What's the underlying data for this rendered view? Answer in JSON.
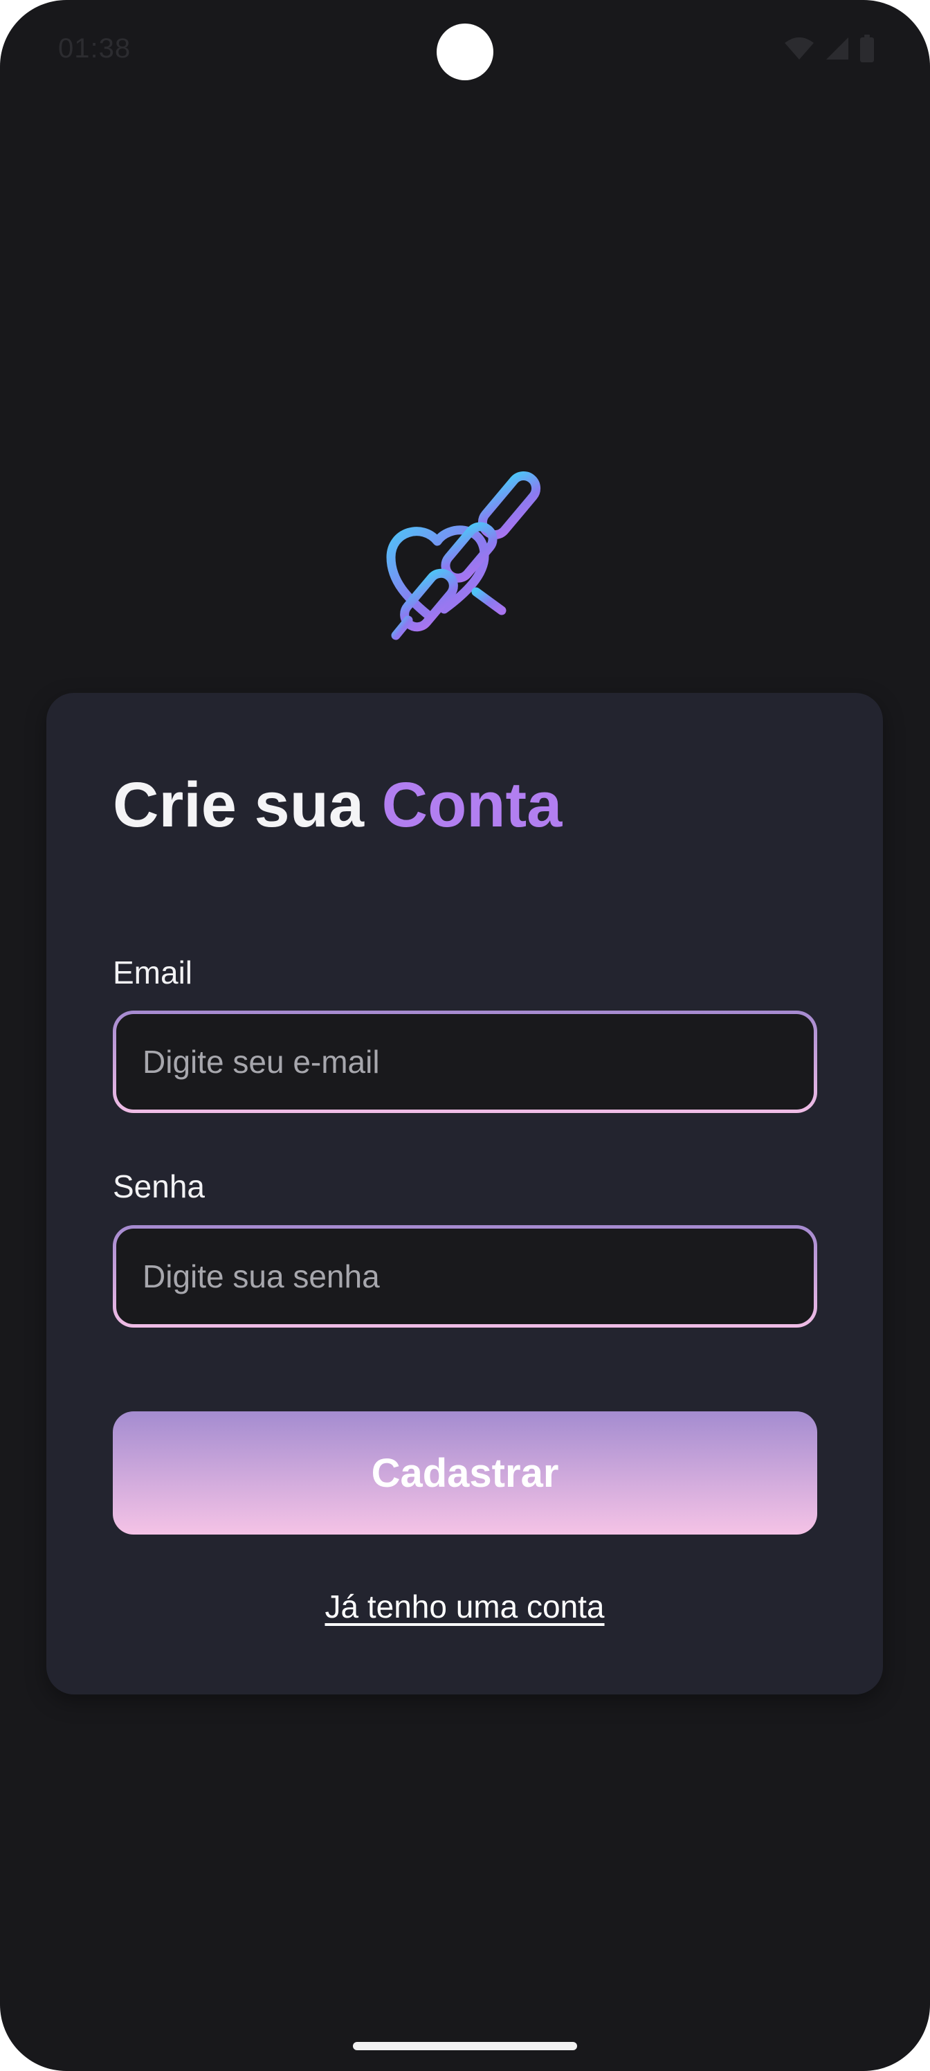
{
  "status_bar": {
    "time": "01:38",
    "icons": [
      "wifi-icon",
      "cellular-signal-icon",
      "battery-icon"
    ]
  },
  "logo": {
    "icon": "heart-chain-logo",
    "gradient": [
      "#4fc3f7",
      "#8b7bf0",
      "#a875f0"
    ]
  },
  "signup": {
    "title_prefix": "Crie sua",
    "title_accent": "Conta",
    "email": {
      "label": "Email",
      "placeholder": "Digite seu e-mail",
      "value": ""
    },
    "password": {
      "label": "Senha",
      "placeholder": "Digite sua senha",
      "value": ""
    },
    "submit_label": "Cadastrar",
    "login_link": "Já tenho uma conta"
  },
  "colors": {
    "background": "#18181b",
    "card": "#23242f",
    "accent": "#b27ff0",
    "border_gradient": [
      "#a58ad0",
      "#f0bde6"
    ],
    "button_gradient": [
      "#a48cd0",
      "#f5c3e6"
    ]
  }
}
